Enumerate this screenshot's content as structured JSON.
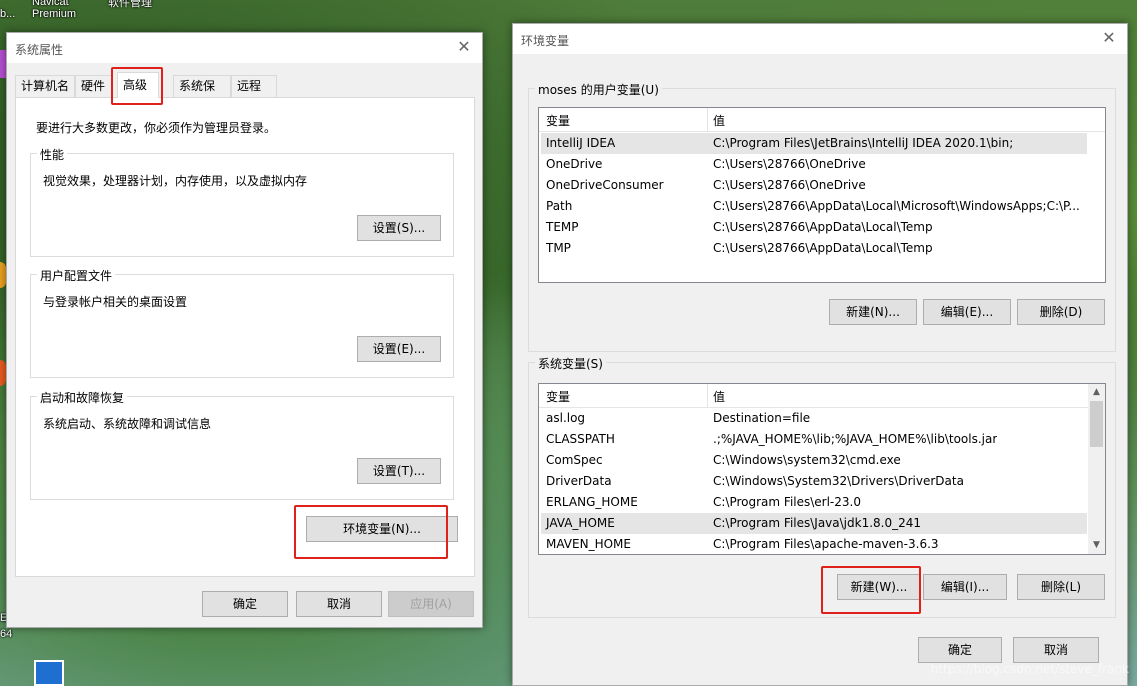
{
  "desktop": {
    "icon_navicat_line1": "Navicat",
    "icon_navicat_line2": "Premium",
    "icon_trunc_1": "b...",
    "icon_trunc_2": "软件管理",
    "icon_left_b": "E",
    "icon_left_64": "64"
  },
  "system_properties": {
    "title": "系统属性",
    "tabs": [
      "计算机名",
      "硬件",
      "高级",
      "系统保护",
      "远程"
    ],
    "active_tab": "高级",
    "admin_note": "要进行大多数更改，你必须作为管理员登录。",
    "performance": {
      "title": "性能",
      "desc": "视觉效果，处理器计划，内存使用，以及虚拟内存",
      "button": "设置(S)..."
    },
    "user_profiles": {
      "title": "用户配置文件",
      "desc": "与登录帐户相关的桌面设置",
      "button": "设置(E)..."
    },
    "startup_recovery": {
      "title": "启动和故障恢复",
      "desc": "系统启动、系统故障和调试信息",
      "button": "设置(T)..."
    },
    "env_button": "环境变量(N)...",
    "ok": "确定",
    "cancel": "取消",
    "apply": "应用(A)"
  },
  "env_vars": {
    "title": "环境变量",
    "user_section_title": "moses 的用户变量(U)",
    "system_section_title": "系统变量(S)",
    "col_variable": "变量",
    "col_value": "值",
    "user_vars": [
      {
        "name": "IntelliJ IDEA",
        "value": "C:\\Program Files\\JetBrains\\IntelliJ IDEA 2020.1\\bin;"
      },
      {
        "name": "OneDrive",
        "value": "C:\\Users\\28766\\OneDrive"
      },
      {
        "name": "OneDriveConsumer",
        "value": "C:\\Users\\28766\\OneDrive"
      },
      {
        "name": "Path",
        "value": "C:\\Users\\28766\\AppData\\Local\\Microsoft\\WindowsApps;C:\\P..."
      },
      {
        "name": "TEMP",
        "value": "C:\\Users\\28766\\AppData\\Local\\Temp"
      },
      {
        "name": "TMP",
        "value": "C:\\Users\\28766\\AppData\\Local\\Temp"
      }
    ],
    "system_vars": [
      {
        "name": "asl.log",
        "value": "Destination=file"
      },
      {
        "name": "CLASSPATH",
        "value": ".;%JAVA_HOME%\\lib;%JAVA_HOME%\\lib\\tools.jar"
      },
      {
        "name": "ComSpec",
        "value": "C:\\Windows\\system32\\cmd.exe"
      },
      {
        "name": "DriverData",
        "value": "C:\\Windows\\System32\\Drivers\\DriverData"
      },
      {
        "name": "ERLANG_HOME",
        "value": "C:\\Program Files\\erl-23.0"
      },
      {
        "name": "JAVA_HOME",
        "value": "C:\\Program Files\\Java\\jdk1.8.0_241"
      },
      {
        "name": "MAVEN_HOME",
        "value": "C:\\Program Files\\apache-maven-3.6.3"
      }
    ],
    "user_new": "新建(N)...",
    "user_edit": "编辑(E)...",
    "user_delete": "删除(D)",
    "sys_new": "新建(W)...",
    "sys_edit": "编辑(I)...",
    "sys_delete": "删除(L)",
    "ok": "确定",
    "cancel": "取消"
  },
  "watermark": "https://blog.csdn.net/steve_frank",
  "colors": {
    "highlight_red": "#e0201b",
    "selection_gray": "#e5e5e5",
    "focus_blue": "#0078d7"
  }
}
